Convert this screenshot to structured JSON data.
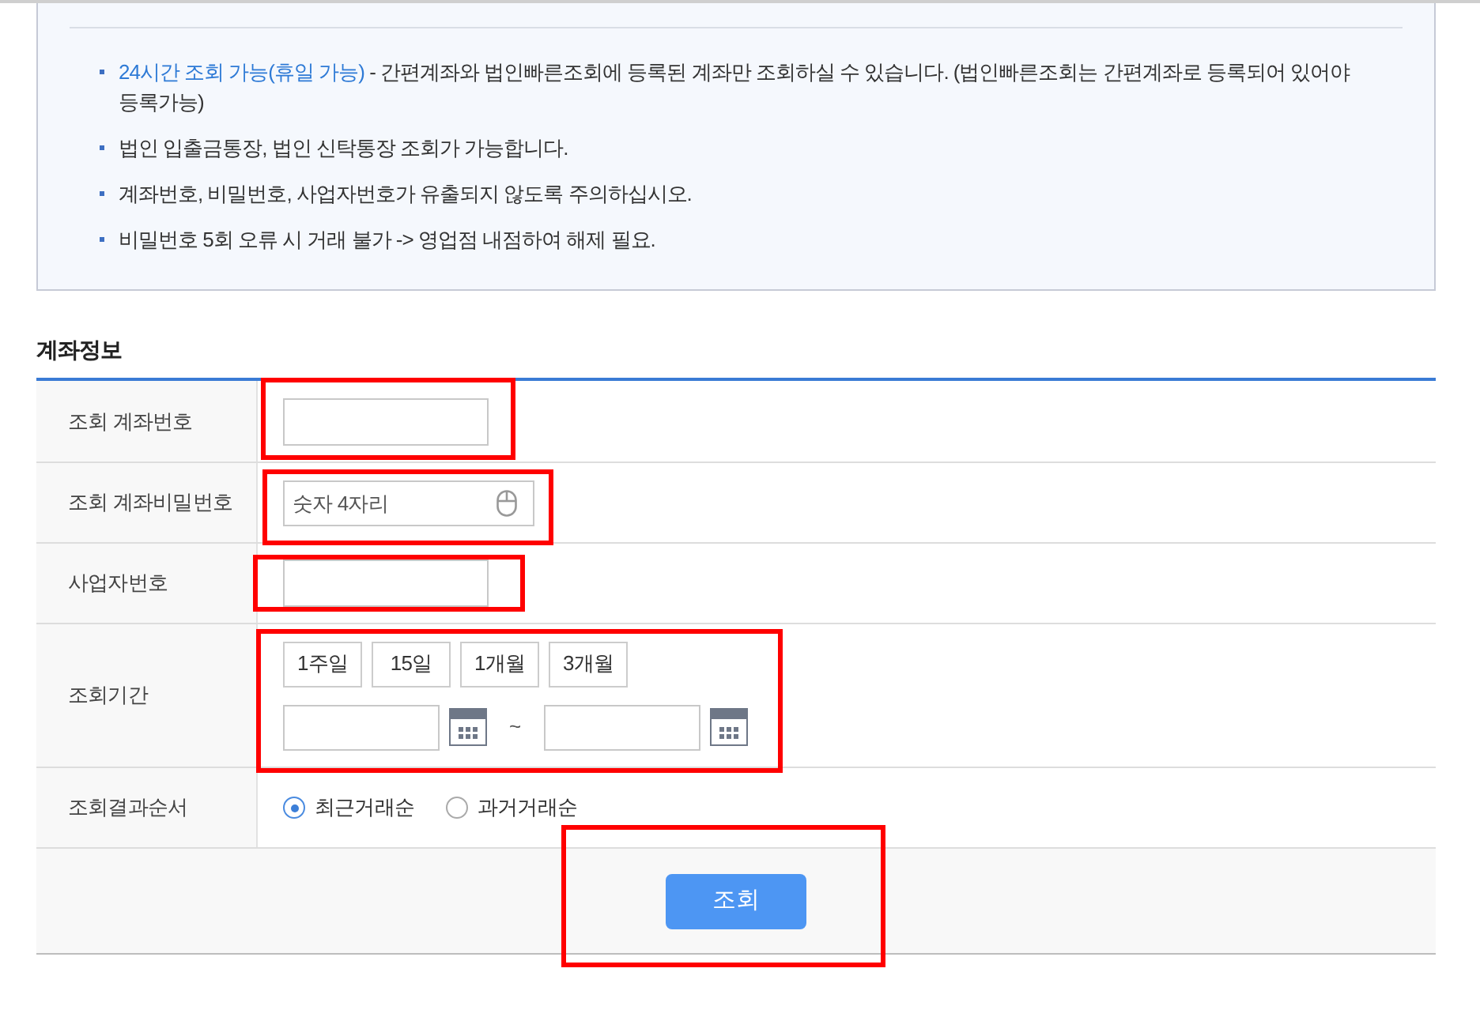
{
  "notice": {
    "items": [
      {
        "emphasis": "24시간 조회 가능(휴일 가능)",
        "text": " - 간편계좌와 법인빠른조회에 등록된 계좌만 조회하실 수 있습니다. (법인빠른조회는 간편계좌로 등록되어 있어야 등록가능)"
      },
      {
        "text": "법인 입출금통장, 법인 신탁통장 조회가 가능합니다."
      },
      {
        "text": "계좌번호, 비밀번호, 사업자번호가 유출되지 않도록 주의하십시오."
      },
      {
        "text": "비밀번호 5회 오류 시 거래 불가 -> 영업점 내점하여 해제 필요."
      }
    ]
  },
  "section_title": "계좌정보",
  "rows": [
    {
      "label": "조회 계좌번호",
      "kind": "text",
      "highlighted": true
    },
    {
      "label": "조회 계좌비밀번호",
      "kind": "password",
      "placeholder": "숫자 4자리",
      "highlighted": true
    },
    {
      "label": "사업자번호",
      "kind": "text",
      "highlighted": true
    },
    {
      "label": "조회기간",
      "kind": "period",
      "periods": [
        "1주일",
        "15일",
        "1개월",
        "3개월"
      ],
      "separator": "~",
      "highlighted": true
    },
    {
      "label": "조회결과순서",
      "kind": "radio",
      "options": [
        {
          "label": "최근거래순",
          "selected": true
        },
        {
          "label": "과거거래순",
          "selected": false
        }
      ]
    }
  ],
  "submit": {
    "label": "조회",
    "highlighted": true
  }
}
